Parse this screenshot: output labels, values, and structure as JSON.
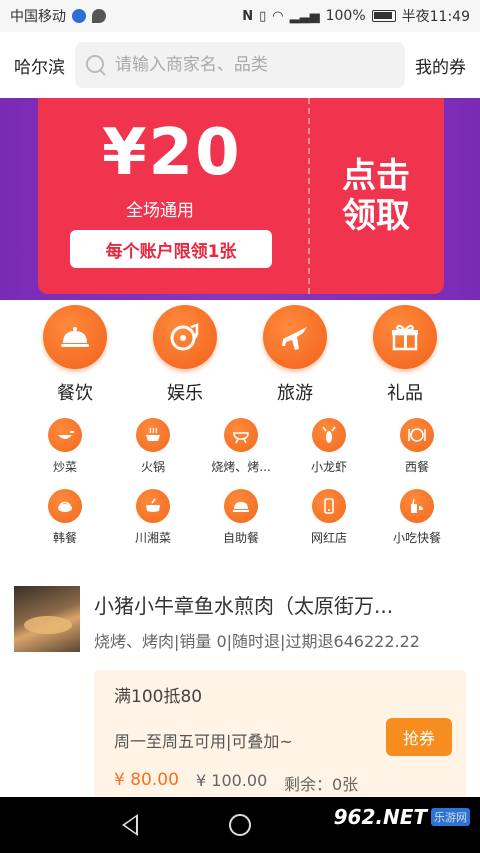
{
  "status_bar": {
    "carrier": "中国移动",
    "battery": "100%",
    "time": "半夜11:49"
  },
  "header": {
    "city": "哈尔滨",
    "search_placeholder": "请输入商家名、品类",
    "my_coupons": "我的券"
  },
  "banner": {
    "amount": "¥20",
    "scope": "全场通用",
    "limit": "每个账户限领1张",
    "claim": "点击领取"
  },
  "main_categories": [
    {
      "label": "餐饮",
      "icon": "dish-cover-icon"
    },
    {
      "label": "娱乐",
      "icon": "music-disc-icon"
    },
    {
      "label": "旅游",
      "icon": "airplane-icon"
    },
    {
      "label": "礼品",
      "icon": "gift-icon"
    }
  ],
  "sub_categories": [
    {
      "label": "炒菜",
      "icon": "wok-icon"
    },
    {
      "label": "火锅",
      "icon": "hotpot-icon"
    },
    {
      "label": "烧烤、烤...",
      "icon": "grill-icon"
    },
    {
      "label": "小龙虾",
      "icon": "crayfish-icon"
    },
    {
      "label": "西餐",
      "icon": "plate-icon"
    },
    {
      "label": "韩餐",
      "icon": "korean-food-icon"
    },
    {
      "label": "川湘菜",
      "icon": "pot-icon"
    },
    {
      "label": "自助餐",
      "icon": "buffet-icon"
    },
    {
      "label": "网红店",
      "icon": "phone-icon"
    },
    {
      "label": "小吃快餐",
      "icon": "fastfood-icon"
    }
  ],
  "shop": {
    "name": "小猪小牛章鱼水煎肉（太原街万...",
    "meta": "烧烤、烤肉|销量 0|随时退|过期退646222.22",
    "deal": {
      "title": "满100抵80",
      "terms": "周一至周五可用|可叠加~",
      "button": "抢券",
      "price": "¥ 80.00",
      "original": "¥ 100.00",
      "remaining": "剩余：0张"
    }
  },
  "watermark": {
    "logo": "962.NET",
    "sub": "乐游网"
  },
  "colors": {
    "accent_orange": "#f06a1f",
    "banner_purple": "#7a2bb5",
    "coupon_red": "#f0344d"
  }
}
